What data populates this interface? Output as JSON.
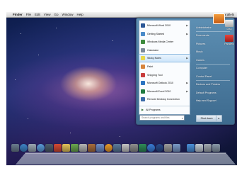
{
  "menubar": {
    "apple": "",
    "items": [
      "Finder",
      "File",
      "Edit",
      "View",
      "Go",
      "Window",
      "Help"
    ],
    "user": "Parallels"
  },
  "startmenu": {
    "programs": [
      {
        "label": "Microsoft Word 2010",
        "color": "#2b5797",
        "submenu": true
      },
      {
        "label": "Getting Started",
        "color": "#4a8bc9",
        "submenu": true
      },
      {
        "label": "Windows Media Center",
        "color": "#3d8a3d",
        "submenu": false
      },
      {
        "label": "Calculator",
        "color": "#7a8a9a",
        "submenu": false
      },
      {
        "label": "Sticky Notes",
        "color": "#e8d84a",
        "submenu": true
      },
      {
        "label": "Paint",
        "color": "#d7843c",
        "submenu": false
      },
      {
        "label": "Snipping Tool",
        "color": "#c83c3c",
        "submenu": false
      },
      {
        "label": "Microsoft Outlook 2010",
        "color": "#2b74c1",
        "submenu": true
      },
      {
        "label": "Microsoft Excel 2010",
        "color": "#1f7a3f",
        "submenu": true
      },
      {
        "label": "Remote Desktop Connection",
        "color": "#3a6aa8",
        "submenu": false
      }
    ],
    "all_programs": "All Programs",
    "search_placeholder": "Search programs and files",
    "places": [
      "Administrator",
      "Documents",
      "Pictures",
      "Music",
      "Games",
      "Computer",
      "Control Panel",
      "Devices and Printers",
      "Default Programs",
      "Help and Support"
    ],
    "shutdown": "Shut down"
  },
  "desktop": {
    "icons": [
      {
        "label": "Disk",
        "color": "#d9d9d9"
      },
      {
        "label": "Parallels",
        "color": "#c8302a"
      }
    ]
  },
  "dock": {
    "colors": [
      "#6a7c8e",
      "#3e83c6",
      "#9aa6b2",
      "#5a9ad8",
      "#4c5c6c",
      "#d34a34",
      "#e2c25a",
      "#6aa84f",
      "#b4b4b4",
      "#a86c3c",
      "#6c8cc8",
      "#e89a2a",
      "#5a7a9a",
      "#c4c4c4",
      "#8e8e8e",
      "#2e8b57",
      "#3a7bd5",
      "#2a4a8a",
      "#9c9c9c",
      "#7a9ac8",
      "#4a90d9",
      "#c0c8d0",
      "#a0a8b0",
      "#8898a8"
    ]
  }
}
